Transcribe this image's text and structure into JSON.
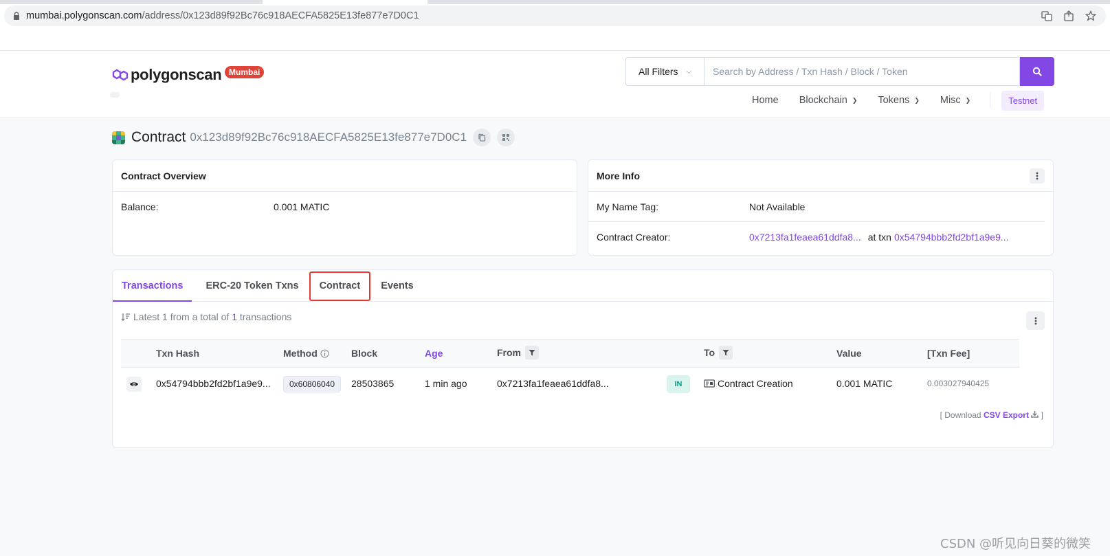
{
  "browser": {
    "url_host": "mumbai.polygonscan.com",
    "url_path": "/address/0x123d89f92Bc76c918AECFA5825E13fe877e7D0C1"
  },
  "header": {
    "logo_text": "polygonscan",
    "network_badge": "Mumbai",
    "filter_label": "All Filters",
    "search_placeholder": "Search by Address / Txn Hash / Block / Token",
    "nav": {
      "home": "Home",
      "blockchain": "Blockchain",
      "tokens": "Tokens",
      "misc": "Misc",
      "testnet": "Testnet"
    }
  },
  "page": {
    "title_word": "Contract",
    "address": "0x123d89f92Bc76c918AECFA5825E13fe877e7D0C1"
  },
  "overview": {
    "title": "Contract Overview",
    "balance_label": "Balance:",
    "balance_value": "0.001 MATIC"
  },
  "more_info": {
    "title": "More Info",
    "name_tag_label": "My Name Tag:",
    "name_tag_value": "Not Available",
    "creator_label": "Contract Creator:",
    "creator_address": "0x7213fa1feaea61ddfa8...",
    "at_txn": "at txn",
    "creator_txn": "0x54794bbb2fd2bf1a9e9..."
  },
  "tabs": {
    "transactions": "Transactions",
    "erc20": "ERC-20 Token Txns",
    "contract": "Contract",
    "events": "Events"
  },
  "summary": {
    "prefix": "Latest 1 from a total of",
    "count": "1",
    "suffix": "transactions"
  },
  "table": {
    "headers": {
      "txn_hash": "Txn Hash",
      "method": "Method",
      "block": "Block",
      "age": "Age",
      "from": "From",
      "to": "To",
      "value": "Value",
      "fee": "[Txn Fee]"
    },
    "rows": [
      {
        "txn_hash": "0x54794bbb2fd2bf1a9e9...",
        "method": "0x60806040",
        "block": "28503865",
        "age": "1 min ago",
        "from": "0x7213fa1feaea61ddfa8...",
        "direction": "IN",
        "to": "Contract Creation",
        "value": "0.001 MATIC",
        "fee": "0.003027940425"
      }
    ]
  },
  "csv": {
    "prefix": "[ Download",
    "link": "CSV Export",
    "suffix": "]"
  },
  "watermark": "CSDN @听见向日葵的微笑",
  "colors": {
    "accent": "#8247e5",
    "badge_red": "#de4437",
    "highlight_border": "#e53935",
    "in_badge_bg": "#d9f4ee",
    "in_badge_text": "#00a186"
  }
}
